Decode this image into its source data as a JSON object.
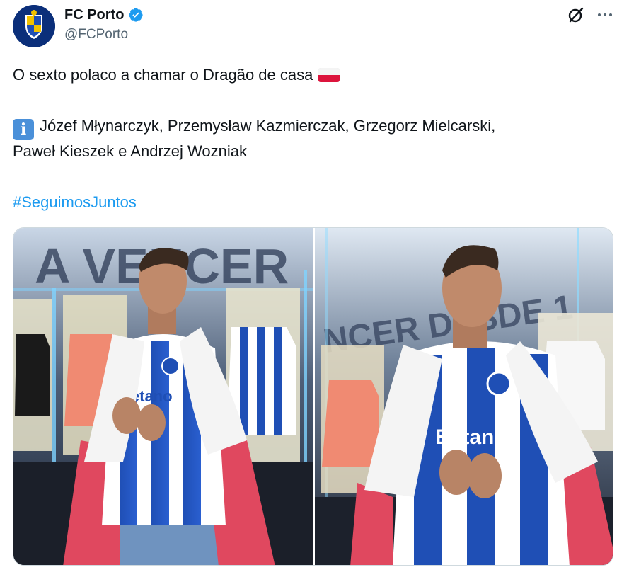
{
  "author": {
    "display_name": "FC Porto",
    "handle": "@FCPorto",
    "verified": true
  },
  "tweet": {
    "line1": "O sexto polaco a chamar o Dragão de casa",
    "line2": "Józef Młynarczyk, Przemysław Kazmierczak, Grzegorz Mielcarski,",
    "line3": "Paweł Kieszek e Andrzej Wozniak",
    "hashtag": "#SeguimosJuntos"
  },
  "photos": {
    "left": {
      "wall_text": "A VENCER",
      "sponsor": "Betano"
    },
    "right": {
      "wall_text": "NCER DESDE 1",
      "sponsor": "Betano"
    }
  },
  "icons": [
    "grok-icon",
    "more-icon",
    "verified-badge-icon",
    "poland-flag-icon",
    "information-icon"
  ],
  "colors": {
    "link": "#1d9bf0",
    "secondary_text": "#536471",
    "verified": "#1d9bf0",
    "porto_blue": "#1f4fb5"
  }
}
